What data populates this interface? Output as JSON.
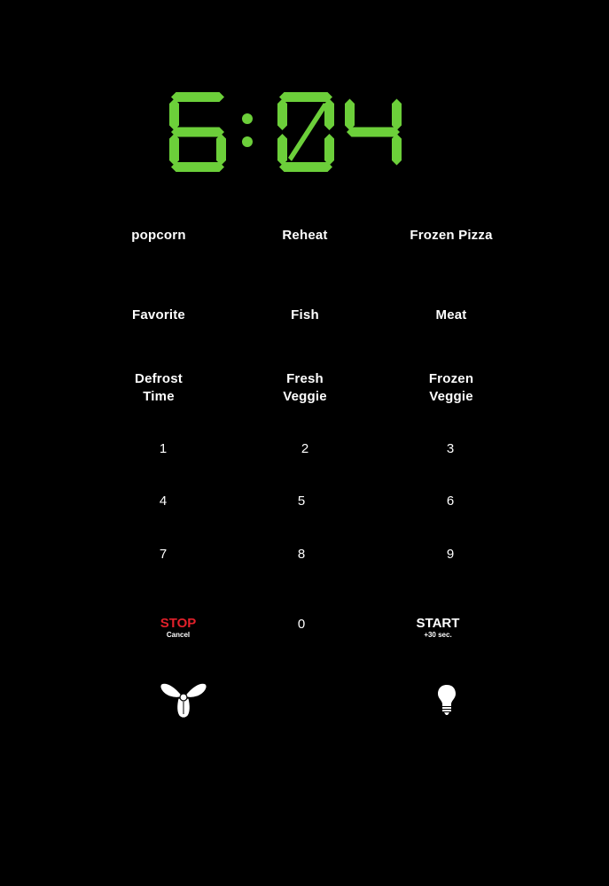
{
  "display": {
    "time": "6:04",
    "color": "#6ccf3a"
  },
  "presets": [
    {
      "label": "popcorn"
    },
    {
      "label": "Reheat"
    },
    {
      "label": "Frozen Pizza"
    },
    {
      "label": "Favorite"
    },
    {
      "label": "Fish"
    },
    {
      "label": "Meat"
    },
    {
      "line1": "Defrost",
      "line2": "Time"
    },
    {
      "line1": "Fresh",
      "line2": "Veggie"
    },
    {
      "line1": "Frozen",
      "line2": "Veggie"
    }
  ],
  "keypad": [
    "1",
    "2",
    "3",
    "4",
    "5",
    "6",
    "7",
    "8",
    "9",
    "0"
  ],
  "stop": {
    "label": "STOP",
    "sub": "Cancel",
    "color": "#e2202a"
  },
  "start": {
    "label": "START",
    "sub": "+30 sec."
  },
  "icons": {
    "fan": "fan-icon",
    "light": "light-bulb-icon"
  }
}
